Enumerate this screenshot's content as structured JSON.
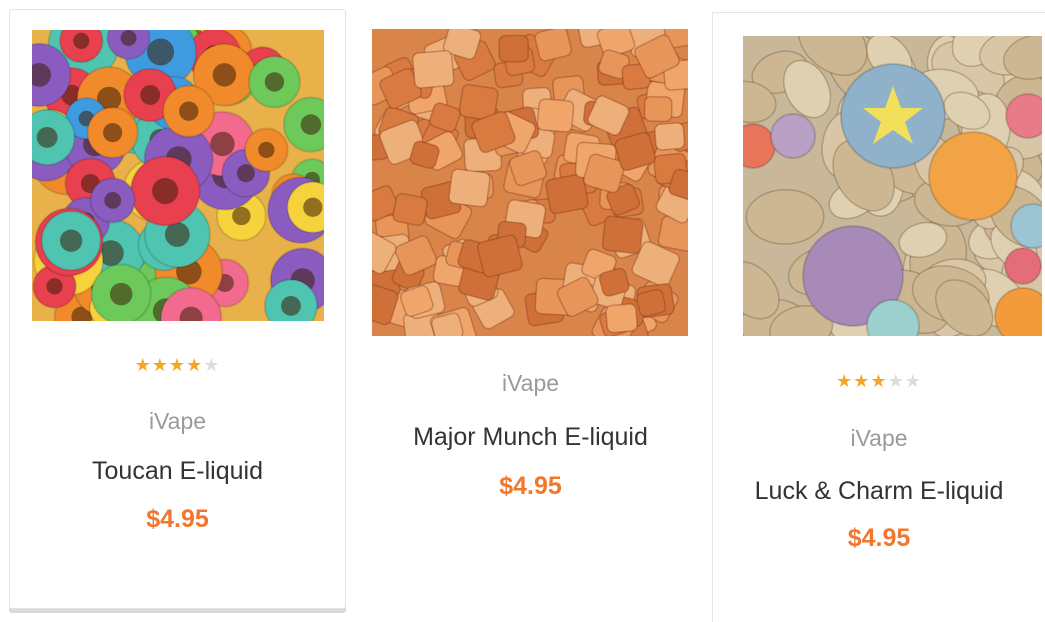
{
  "products": [
    {
      "image_alt": "toucan cereal rings",
      "rating": 4,
      "rating_max": 5,
      "brand": "iVape",
      "name": "Toucan E-liquid",
      "price": "$4.95"
    },
    {
      "image_alt": "crunch cereal squares",
      "brand": "iVape",
      "name": "Major Munch E-liquid",
      "price": "$4.95"
    },
    {
      "image_alt": "charms cereal with marshmallows",
      "rating": 3,
      "rating_max": 5,
      "brand": "iVape",
      "name": "Luck & Charm E-liquid",
      "price": "$4.95"
    }
  ],
  "colors": {
    "star_on": "#f5a623",
    "star_off": "#dcdcdc",
    "price": "#f2772e",
    "brand": "#9a9a9a",
    "name": "#333333"
  }
}
